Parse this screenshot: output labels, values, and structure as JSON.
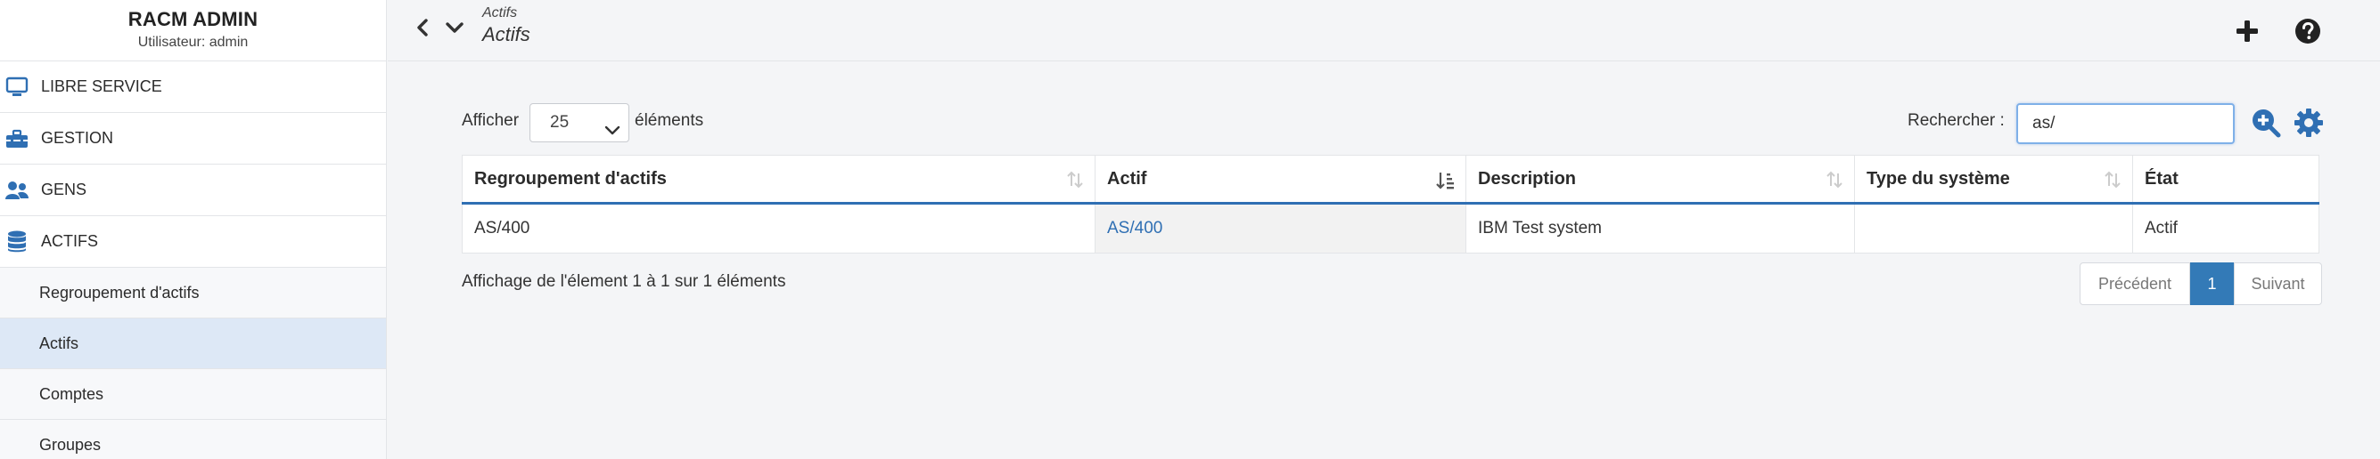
{
  "sidebar": {
    "app_title": "RACM ADMIN",
    "user_label": "Utilisateur: admin",
    "sections": [
      {
        "label": "LIBRE SERVICE",
        "icon": "monitor-icon"
      },
      {
        "label": "GESTION",
        "icon": "toolbox-icon"
      },
      {
        "label": "GENS",
        "icon": "users-icon"
      },
      {
        "label": "ACTIFS",
        "icon": "database-icon"
      }
    ],
    "subitems": [
      {
        "label": "Regroupement d'actifs",
        "active": false
      },
      {
        "label": "Actifs",
        "active": true
      },
      {
        "label": "Comptes",
        "active": false
      },
      {
        "label": "Groupes",
        "active": false
      }
    ]
  },
  "topbar": {
    "breadcrumb_parent": "Actifs",
    "breadcrumb_current": "Actifs",
    "icons": [
      "chevron-left-icon",
      "chevron-down-icon",
      "plus-icon",
      "help-icon"
    ]
  },
  "main": {
    "show_label": "Afficher",
    "page_size": "25",
    "entries_label": "éléments",
    "search_label": "Rechercher :",
    "search_value": "as/",
    "table": {
      "columns": [
        "Regroupement d'actifs",
        "Actif",
        "Description",
        "Type du système",
        "État"
      ],
      "rows": [
        [
          "AS/400",
          "AS/400",
          "IBM Test system",
          "",
          "Actif"
        ]
      ]
    },
    "info_text": "Affichage de l'élement 1 à 1 sur 1 éléments",
    "pagination": {
      "previous": "Précédent",
      "current": "1",
      "next": "Suivant"
    }
  },
  "colors": {
    "accent": "#2f6fb3",
    "active_row": "#dde8f6",
    "background": "#f4f5f7"
  }
}
